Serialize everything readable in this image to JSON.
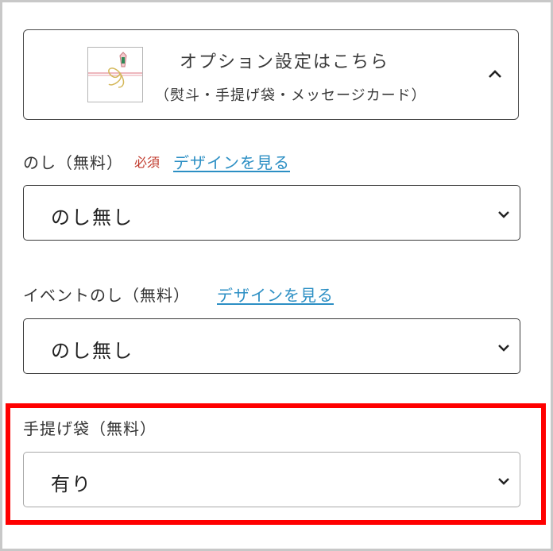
{
  "options": {
    "title": "オプション設定はこちら",
    "subtitle": "（熨斗・手提げ袋・メッセージカード）"
  },
  "noshi": {
    "label": "のし（無料）",
    "required": "必須",
    "design_link": "デザインを見る",
    "selected": "のし無し"
  },
  "event_noshi": {
    "label": "イベントのし（無料）",
    "design_link": "デザインを見る",
    "selected": "のし無し"
  },
  "bag": {
    "label": "手提げ袋（無料）",
    "selected": "有り"
  },
  "colors": {
    "link": "#2c8fc4",
    "required": "#c0392b",
    "highlight": "#ff0000"
  }
}
